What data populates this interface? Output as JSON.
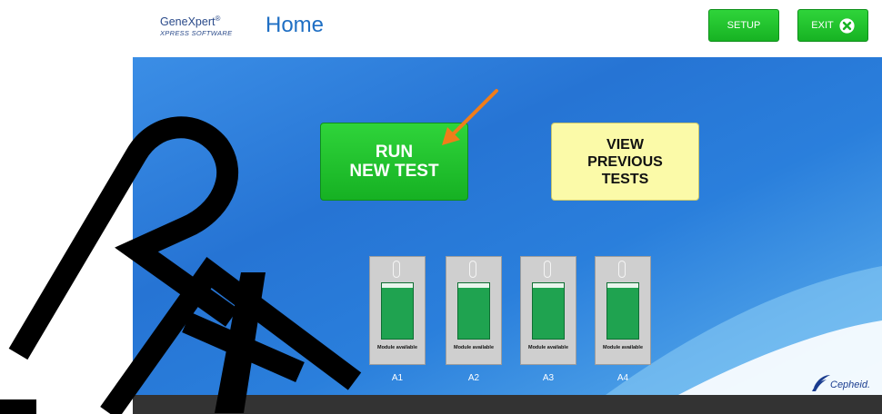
{
  "header": {
    "logo_line1": "GeneXpert",
    "logo_reg": "®",
    "logo_line2": "XPRESS SOFTWARE",
    "title": "Home",
    "setup_label": "SETUP",
    "exit_label": "EXIT"
  },
  "main": {
    "run_line1": "RUN",
    "run_line2": "NEW TEST",
    "view_line1": "VIEW",
    "view_line2": "PREVIOUS",
    "view_line3": "TESTS",
    "modules": [
      {
        "label": "A1",
        "status": "Module available"
      },
      {
        "label": "A2",
        "status": "Module available"
      },
      {
        "label": "A3",
        "status": "Module available"
      },
      {
        "label": "A4",
        "status": "Module available"
      }
    ],
    "brand": "Cepheid."
  },
  "colors": {
    "accent_green": "#17b323",
    "title_blue": "#1f6fc4",
    "panel_blue": "#2674d4",
    "view_yellow": "#fbfaa8",
    "arrow_orange": "#f07d1a"
  },
  "icons": {
    "exit": "x-circle-icon",
    "arrow": "pointer-arrow-icon",
    "brand": "cepheid-logo-icon"
  }
}
